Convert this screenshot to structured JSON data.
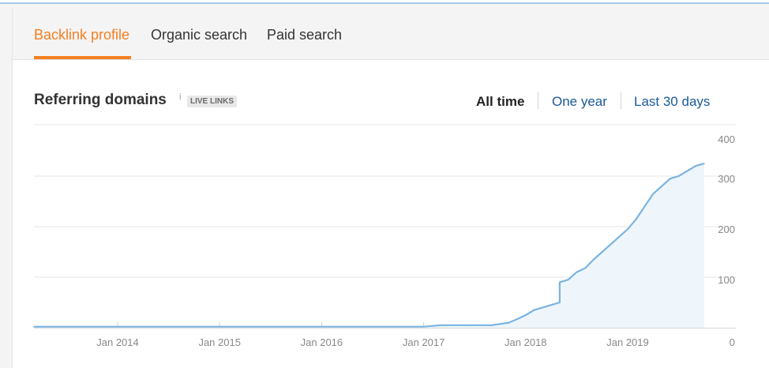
{
  "tabs": [
    {
      "label": "Backlink profile",
      "active": true
    },
    {
      "label": "Organic search",
      "active": false
    },
    {
      "label": "Paid search",
      "active": false
    }
  ],
  "card": {
    "title": "Referring domains",
    "info_marker": "i",
    "badge": "LIVE LINKS"
  },
  "time_ranges": [
    {
      "label": "All time",
      "selected": true
    },
    {
      "label": "One year",
      "selected": false
    },
    {
      "label": "Last 30 days",
      "selected": false
    }
  ],
  "colors": {
    "accent": "#f47e20",
    "link": "#1a5a96",
    "line": "#7ab4e2",
    "area": "#eef6fb"
  },
  "chart_data": {
    "type": "area",
    "ylim": [
      0,
      400
    ],
    "y_ticks": [
      "400",
      "300",
      "200",
      "100",
      "0"
    ],
    "x_ticks": [
      "Jan 2014",
      "Jan 2015",
      "Jan 2016",
      "Jan 2017",
      "Jan 2018",
      "Jan 2019"
    ],
    "grid": true,
    "series": [
      {
        "x": [
          "2013-02",
          "2014-01",
          "2015-01",
          "2016-01",
          "2017-01",
          "2017-03",
          "2017-06",
          "2017-09",
          "2017-11",
          "2017-12",
          "2018-01",
          "2018-02",
          "2018-03",
          "2018-04",
          "2018-05",
          "2018-05",
          "2018-06",
          "2018-07",
          "2018-08",
          "2018-09",
          "2018-10",
          "2018-11",
          "2018-12",
          "2019-01",
          "2019-02",
          "2019-03",
          "2019-04",
          "2019-05",
          "2019-06",
          "2019-07",
          "2019-08",
          "2019-09",
          "2019-10"
        ],
        "values": [
          2,
          2,
          2,
          2,
          2,
          5,
          5,
          5,
          10,
          17,
          25,
          35,
          40,
          45,
          50,
          90,
          95,
          110,
          118,
          135,
          150,
          165,
          180,
          195,
          215,
          240,
          265,
          280,
          295,
          300,
          310,
          320,
          325
        ]
      }
    ]
  }
}
